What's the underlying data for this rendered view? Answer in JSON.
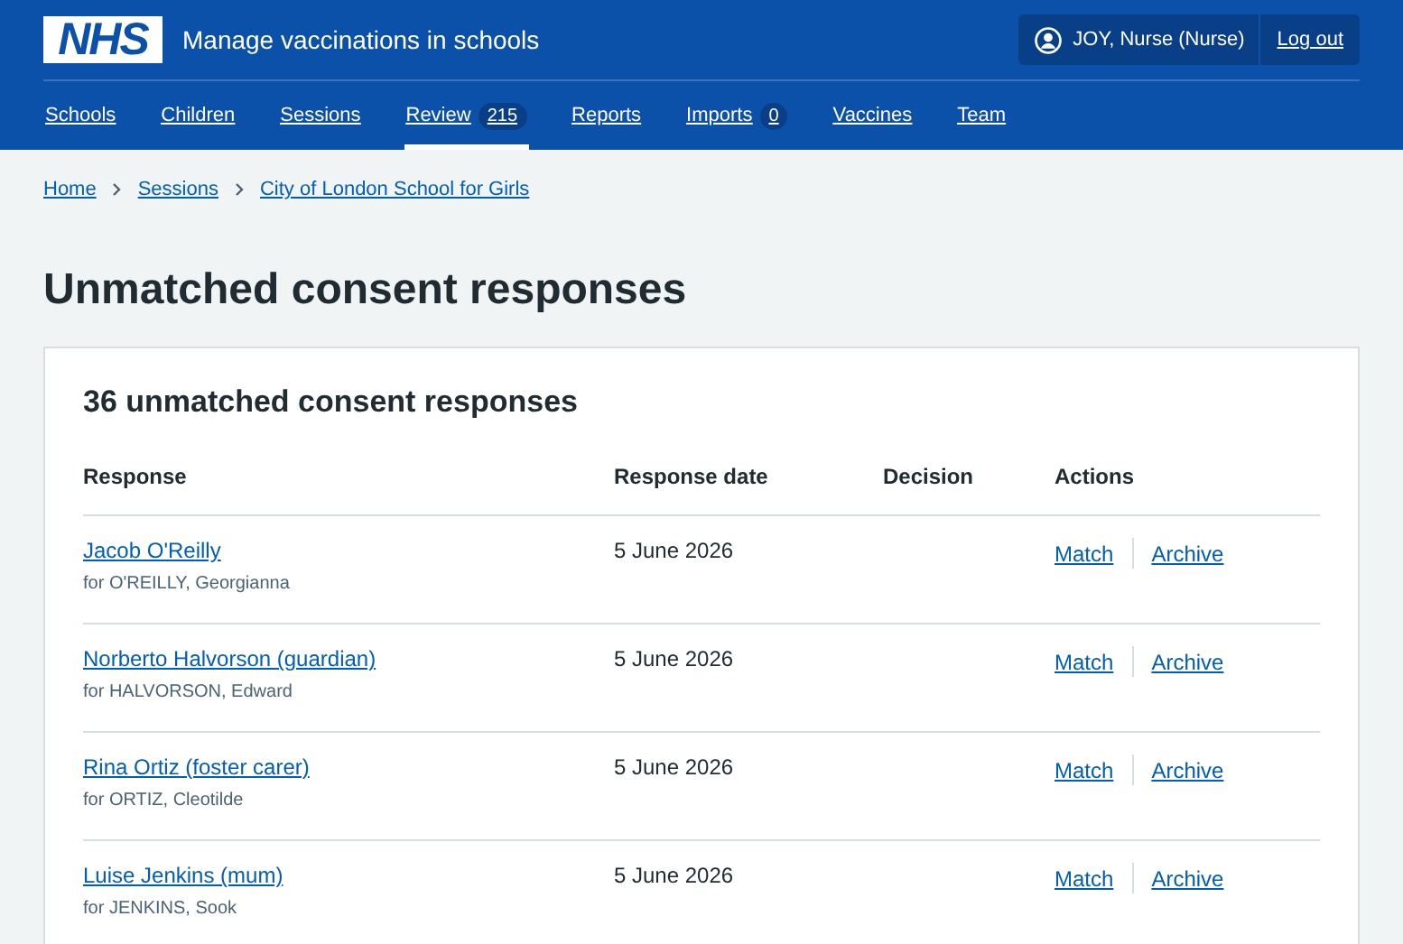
{
  "header": {
    "logo": "NHS",
    "service_name": "Manage vaccinations in schools",
    "user": "JOY, Nurse (Nurse)",
    "logout": "Log out"
  },
  "nav": [
    {
      "label": "Schools",
      "selected": false
    },
    {
      "label": "Children",
      "selected": false
    },
    {
      "label": "Sessions",
      "selected": false
    },
    {
      "label": "Review",
      "count": "215",
      "selected": true
    },
    {
      "label": "Reports",
      "selected": false
    },
    {
      "label": "Imports",
      "count": "0",
      "selected": false
    },
    {
      "label": "Vaccines",
      "selected": false
    },
    {
      "label": "Team",
      "selected": false
    }
  ],
  "breadcrumbs": [
    "Home",
    "Sessions",
    "City of London School for Girls"
  ],
  "page_title": "Unmatched consent responses",
  "card": {
    "heading": "36 unmatched consent responses",
    "table": {
      "columns": [
        "Response",
        "Response date",
        "Decision",
        "Actions"
      ],
      "rows": [
        {
          "response": "Jacob O'Reilly",
          "child": "for O'REILLY, Georgianna",
          "date": "5 June 2026",
          "actions": [
            "Match",
            "Archive"
          ]
        },
        {
          "response": "Norberto Halvorson (guardian)",
          "child": "for HALVORSON, Edward",
          "date": "5 June 2026",
          "actions": [
            "Match",
            "Archive"
          ]
        },
        {
          "response": "Rina Ortiz (foster carer)",
          "child": "for ORTIZ, Cleotilde",
          "date": "5 June 2026",
          "actions": [
            "Match",
            "Archive"
          ]
        },
        {
          "response": "Luise Jenkins (mum)",
          "child": "for JENKINS, Sook",
          "date": "5 June 2026",
          "actions": [
            "Match",
            "Archive"
          ]
        }
      ]
    }
  }
}
